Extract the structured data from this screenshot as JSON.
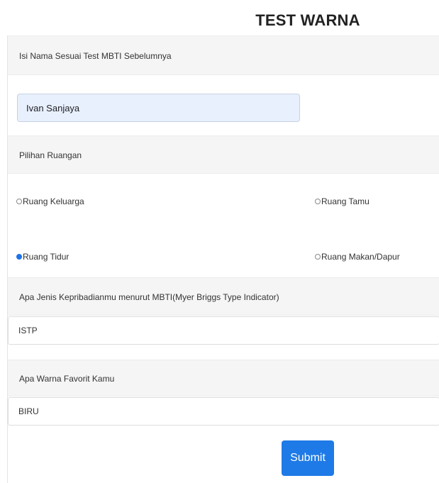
{
  "page": {
    "title": "TEST WARNA"
  },
  "name_section": {
    "label": "Isi Nama Sesuai Test MBTI Sebelumnya",
    "value": "Ivan Sanjaya"
  },
  "room_section": {
    "label": "Pilihan Ruangan",
    "options": [
      {
        "label": "Ruang Keluarga",
        "checked": false
      },
      {
        "label": "Ruang Tamu",
        "checked": false
      },
      {
        "label": "Ruang Tidur",
        "checked": true
      },
      {
        "label": "Ruang Makan/Dapur",
        "checked": false
      }
    ]
  },
  "mbti_section": {
    "label": "Apa Jenis Kepribadianmu menurut MBTI(Myer Briggs Type Indicator)",
    "value": "ISTP"
  },
  "color_section": {
    "label": "Apa Warna Favorit Kamu",
    "value": "BIRU"
  },
  "submit": {
    "label": "Submit"
  },
  "colors": {
    "accent": "#1e7ae6",
    "input_highlight": "#e8f0fe",
    "section_bg": "#f5f5f5"
  }
}
